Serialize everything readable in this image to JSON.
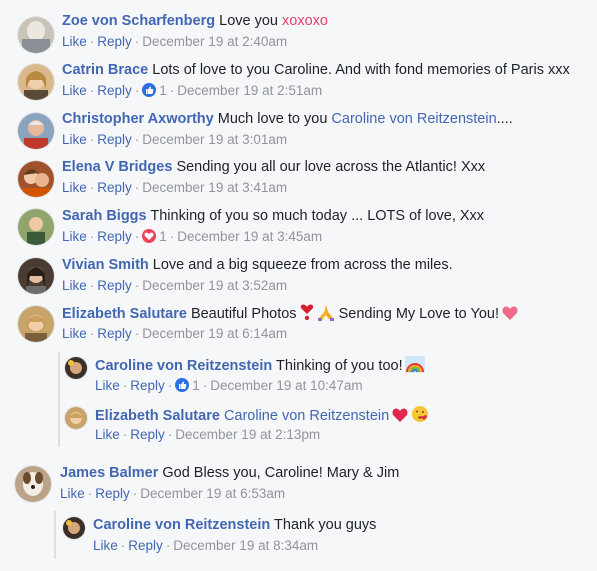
{
  "actions": {
    "like": "Like",
    "reply": "Reply"
  },
  "colors": {
    "link": "#4267b2",
    "meta": "#90949c",
    "xoxo": "#e8406a"
  },
  "comments": [
    {
      "author": "Zoe von Scharfenberg",
      "text": "Love you",
      "highlight": "xoxoxo",
      "time": "December 19 at 2:40am"
    },
    {
      "author": "Catrin Brace",
      "text": "Lots of love to you Caroline. And with fond memories of Paris xxx",
      "reaction": "like-icon",
      "reaction_count": "1",
      "time": "December 19 at 2:51am"
    },
    {
      "author": "Christopher Axworthy",
      "text": "Much love to you",
      "mention": "Caroline von Reitzenstein",
      "text_after": "....",
      "time": "December 19 at 3:01am"
    },
    {
      "author": "Elena V Bridges",
      "text": "Sending you all our love across the Atlantic! Xxx",
      "time": "December 19 at 3:41am"
    },
    {
      "author": "Sarah Biggs",
      "text": "Thinking of you so much today ... LOTS of love, Xxx",
      "reaction": "love-icon",
      "reaction_count": "1",
      "time": "December 19 at 3:45am"
    },
    {
      "author": "Vivian Smith",
      "text": "Love and a big squeeze from across the miles.",
      "time": "December 19 at 3:52am"
    },
    {
      "author": "Elizabeth Salutare",
      "text": "Beautiful Photos",
      "text_after": "Sending My Love to You!",
      "emojis": [
        "heart-exclamation-emoji",
        "praying-hands-emoji",
        "pink-heart-emoji"
      ],
      "time": "December 19 at 6:14am"
    },
    {
      "author": "Caroline von Reitzenstein",
      "text": "Thinking of you too!",
      "emojis": [
        "rainbow-emoji"
      ],
      "reaction": "like-icon",
      "reaction_count": "1",
      "time": "December 19 at 10:47am"
    },
    {
      "author": "Elizabeth Salutare",
      "mention": "Caroline von Reitzenstein",
      "emojis": [
        "red-heart-emoji",
        "kissing-face-emoji"
      ],
      "time": "December 19 at 2:13pm"
    },
    {
      "author": "James Balmer",
      "text": "God Bless you, Caroline! Mary & Jim",
      "time": "December 19 at 6:53am"
    },
    {
      "author": "Caroline von Reitzenstein",
      "text": "Thank you guys",
      "time": "December 19 at 8:34am"
    }
  ]
}
